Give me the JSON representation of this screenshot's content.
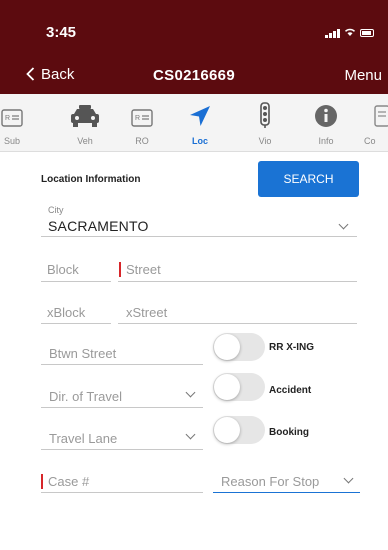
{
  "status_bar": {
    "time": "3:45"
  },
  "nav": {
    "back_label": "Back",
    "title": "CS0216669",
    "menu_label": "Menu"
  },
  "tabs": [
    {
      "label": "Sub",
      "icon": "id-card-icon"
    },
    {
      "label": "Veh",
      "icon": "car-icon"
    },
    {
      "label": "RO",
      "icon": "id-card-icon"
    },
    {
      "label": "Loc",
      "icon": "location-arrow-icon",
      "active": true
    },
    {
      "label": "Vio",
      "icon": "traffic-light-icon"
    },
    {
      "label": "Info",
      "icon": "info-icon"
    },
    {
      "label": "Co",
      "icon": "document-icon"
    }
  ],
  "section": {
    "title": "Location Information",
    "search_label": "SEARCH"
  },
  "city": {
    "label": "City",
    "value": "SACRAMENTO"
  },
  "fields": {
    "block": "Block",
    "street": "Street",
    "xblock": "xBlock",
    "xstreet": "xStreet",
    "btwn_street": "Btwn Street",
    "dir_travel": "Dir. of Travel",
    "travel_lane": "Travel Lane",
    "case_number": "Case #",
    "reason_for_stop": "Reason For Stop"
  },
  "toggles": {
    "rr_xing": {
      "label": "RR X-ING",
      "on": false
    },
    "accident": {
      "label": "Accident",
      "on": false
    },
    "booking": {
      "label": "Booking",
      "on": false
    }
  },
  "colors": {
    "brand": "#5c0b0f",
    "accent": "#1a73d4",
    "required": "#d7262a"
  }
}
